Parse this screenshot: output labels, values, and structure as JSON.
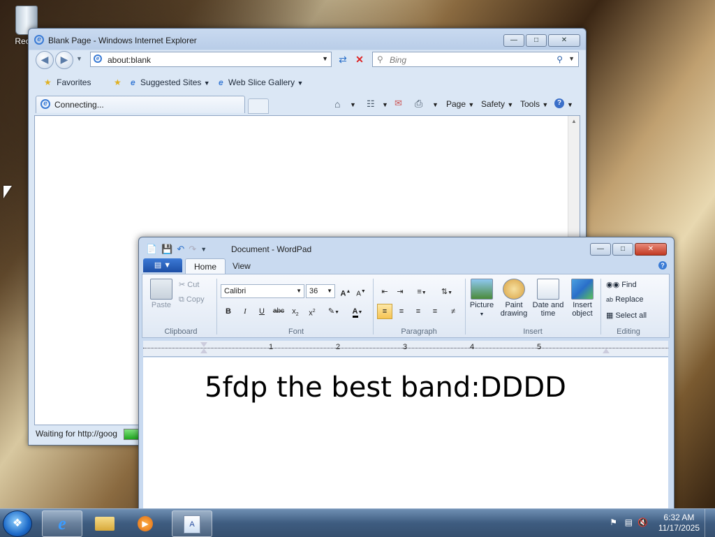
{
  "desktop": {
    "recycle_label": "Recyc"
  },
  "ie": {
    "title": "Blank Page - Windows Internet Explorer",
    "address": "about:blank",
    "search_placeholder": "Bing",
    "favorites_label": "Favorites",
    "suggested_sites": "Suggested Sites",
    "web_slice_gallery": "Web Slice Gallery",
    "tab_title": "Connecting...",
    "menu_page": "Page",
    "menu_safety": "Safety",
    "menu_tools": "Tools",
    "status_text": "Waiting for http://gooɡ",
    "progress_fraction": 0.6
  },
  "wordpad": {
    "title": "Document - WordPad",
    "tabs": [
      "Home",
      "View"
    ],
    "clipboard": {
      "paste": "Paste",
      "cut": "Cut",
      "copy": "Copy",
      "label": "Clipboard"
    },
    "font": {
      "family": "Calibri",
      "size": "36",
      "label": "Font"
    },
    "paragraph": {
      "label": "Paragraph"
    },
    "insert": {
      "picture": "Picture",
      "paint_drawing_1": "Paint",
      "paint_drawing_2": "drawing",
      "date_time_1": "Date and",
      "date_time_2": "time",
      "insert_object_1": "Insert",
      "insert_object_2": "object",
      "label": "Insert"
    },
    "editing": {
      "find": "Find",
      "replace": "Replace",
      "select_all": "Select all",
      "label": "Editing"
    },
    "ruler_numbers": [
      "1",
      "2",
      "3",
      "4",
      "5"
    ],
    "document_text": "5fdp the best band:DDDD"
  },
  "taskbar": {
    "time": "6:32 AM",
    "date": "11/17/2025"
  },
  "colors": {
    "accent": "#3a7bd5",
    "taskbar": "#3e5c80",
    "close_red": "#c23a22"
  }
}
